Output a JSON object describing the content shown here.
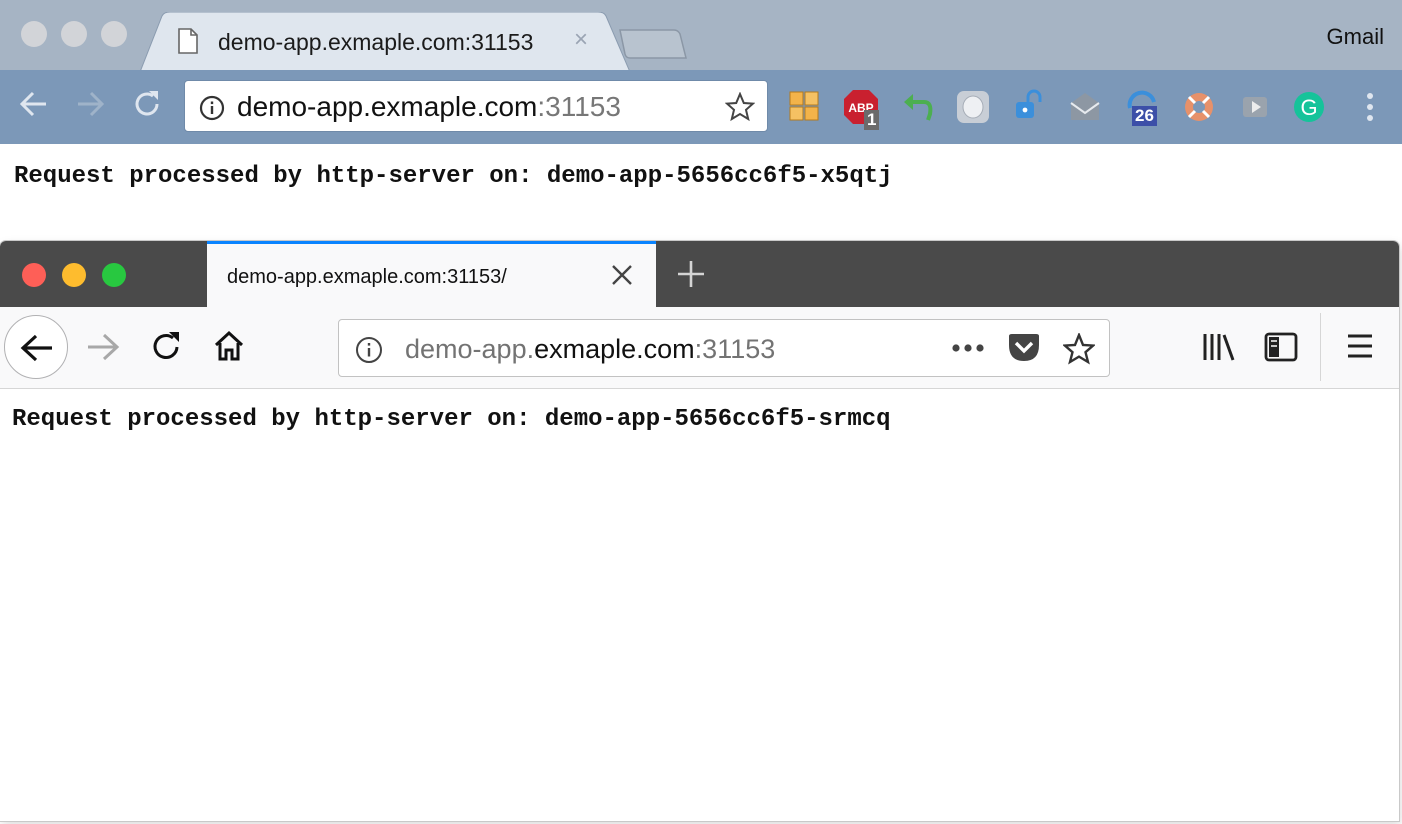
{
  "chrome": {
    "tab_title": "demo-app.exmaple.com:31153",
    "tab_close": "×",
    "profile_name": "Gmail",
    "url_host": "demo-app.exmaple.com",
    "url_port": ":31153",
    "extensions": {
      "adblock_label": "ABP",
      "adblock_badge": "1",
      "calendar_badge": "26",
      "grammarly_letter": "G"
    },
    "page_text": "Request processed by http-server on: demo-app-5656cc6f5-x5qtj"
  },
  "firefox": {
    "tab_title": "demo-app.exmaple.com:31153/",
    "url_prefix": "demo-app.",
    "url_host": "exmaple.com",
    "url_port": ":31153",
    "page_text": "Request processed by http-server on: demo-app-5656cc6f5-srmcq"
  },
  "colors": {
    "chrome_toolbar": "#7c98b8",
    "firefox_tabstrip": "#4a4a4a",
    "firefox_accent": "#0a84ff",
    "mac_close": "#fe5f57",
    "mac_minimize": "#febc2e",
    "mac_zoom": "#28c840"
  },
  "icons": [
    "page-icon",
    "back-arrow-icon",
    "forward-arrow-icon",
    "reload-icon",
    "info-icon",
    "star-icon",
    "home-icon",
    "pocket-icon",
    "library-icon",
    "sidebar-icon",
    "hamburger-menu-icon",
    "kebab-menu-icon",
    "plus-icon",
    "close-icon"
  ]
}
